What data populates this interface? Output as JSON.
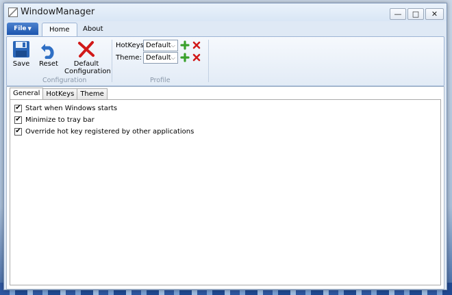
{
  "window": {
    "title": "WindowManager"
  },
  "ribbon_tabs": {
    "file": "File",
    "home": "Home",
    "about": "About"
  },
  "ribbon": {
    "buttons": {
      "save": "Save",
      "reset": "Reset",
      "default_line1": "Default",
      "default_line2": "Configuration"
    },
    "groups": {
      "configuration": "Configuration",
      "profile": "Profile"
    },
    "profile": {
      "hotkeys_label": "HotKeys:",
      "hotkeys_value": "Default",
      "theme_label": "Theme:",
      "theme_value": "Default"
    }
  },
  "content_tabs": {
    "general": "General",
    "hotkeys": "HotKeys",
    "theme": "Theme"
  },
  "options": {
    "start_windows": "Start when Windows starts",
    "minimize_tray": "Minimize to tray bar",
    "override_hotkey": "Override hot key registered by other applications"
  },
  "icons": {
    "save": "floppy-disk-icon",
    "reset": "undo-arrow-icon",
    "default": "red-x-icon",
    "add": "green-plus-icon",
    "remove": "red-x-icon"
  },
  "colors": {
    "accent": "#1d55ad",
    "add_green": "#3aa12c",
    "remove_red": "#d11919"
  }
}
